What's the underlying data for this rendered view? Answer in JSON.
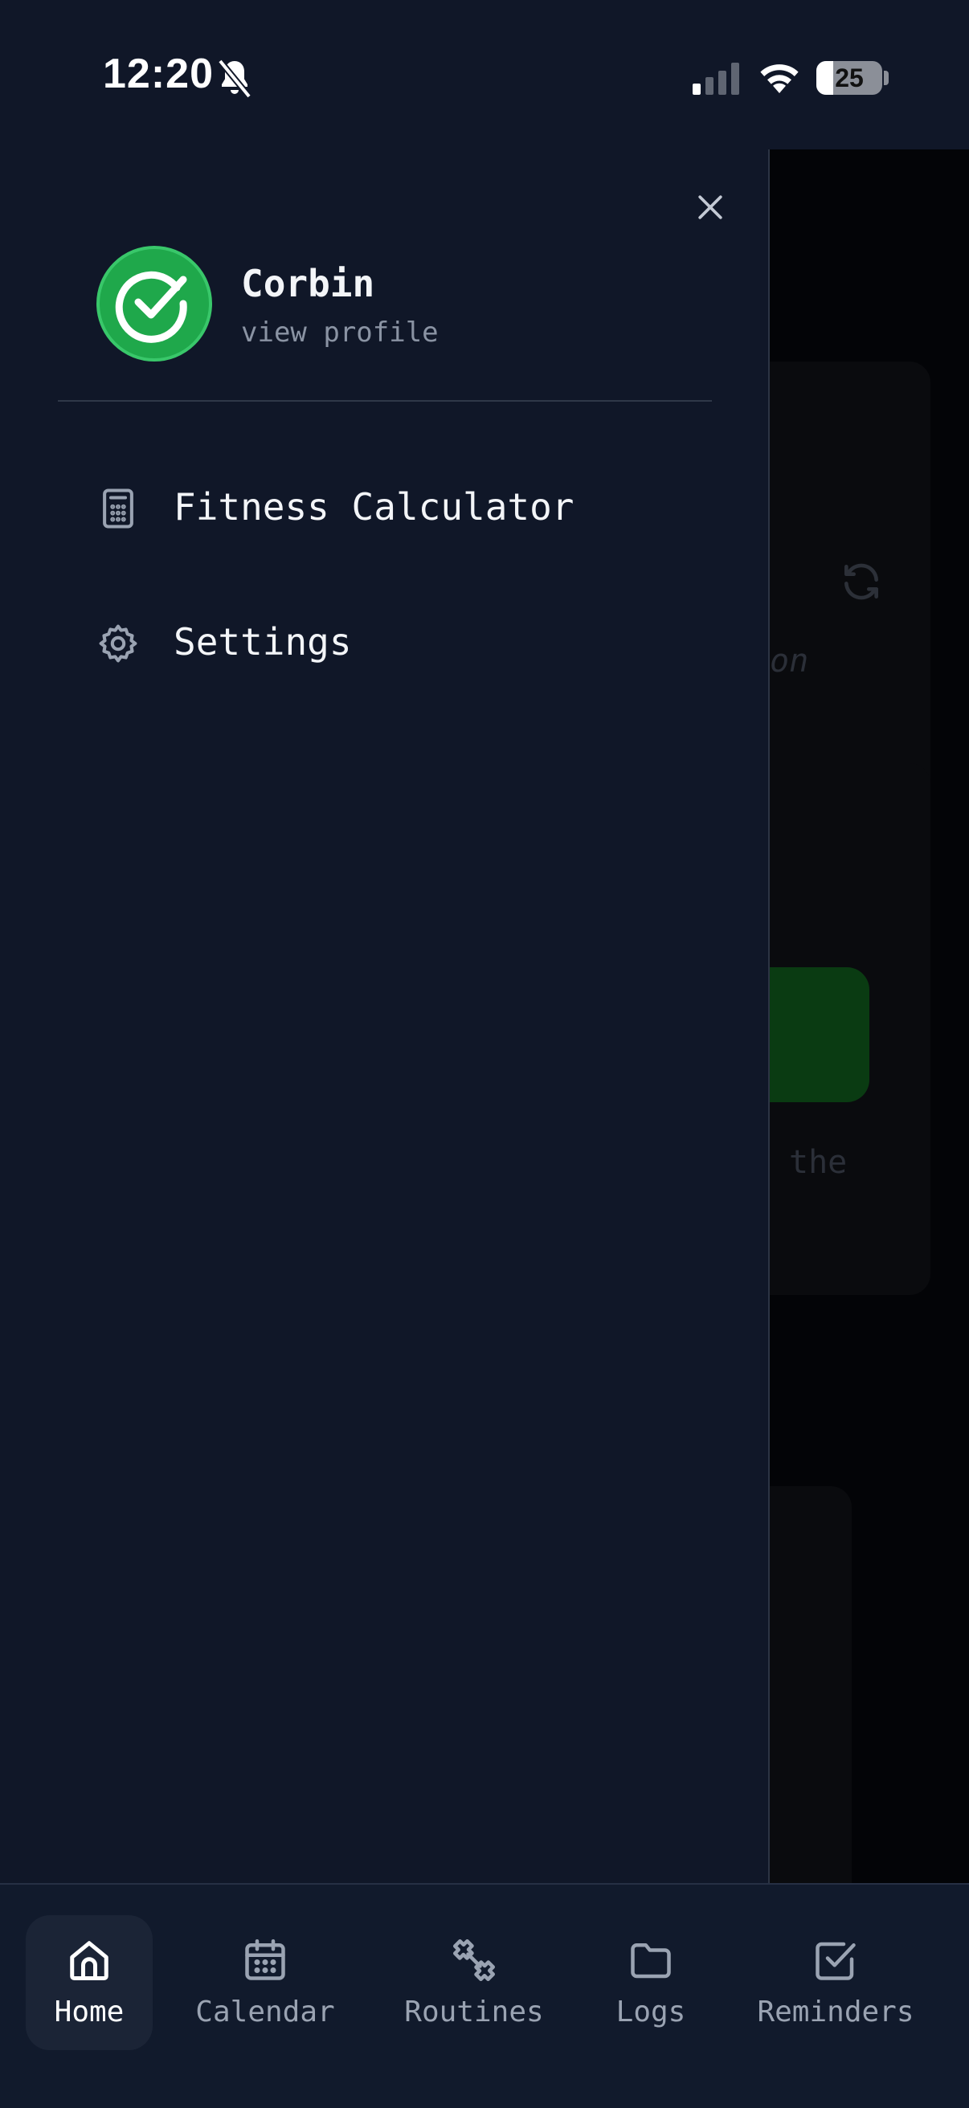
{
  "status_bar": {
    "time": "12:20",
    "battery": "25",
    "battery_level": 0.25
  },
  "background": {
    "card1_text": "on",
    "card2_text": "the",
    "accent_green": "#0a3b12"
  },
  "drawer": {
    "user_name": "Corbin",
    "user_subtitle": "view profile",
    "avatar_color": "#1ea84a",
    "menu": [
      {
        "label": "Fitness Calculator",
        "icon": "calculator-icon"
      },
      {
        "label": "Settings",
        "icon": "gear-icon"
      }
    ]
  },
  "bottom_nav": {
    "active": "Home",
    "items": [
      {
        "label": "Home",
        "icon": "home-icon"
      },
      {
        "label": "Calendar",
        "icon": "calendar-icon"
      },
      {
        "label": "Routines",
        "icon": "dumbbell-icon"
      },
      {
        "label": "Logs",
        "icon": "folder-icon"
      },
      {
        "label": "Reminders",
        "icon": "checkbox-icon"
      }
    ]
  }
}
